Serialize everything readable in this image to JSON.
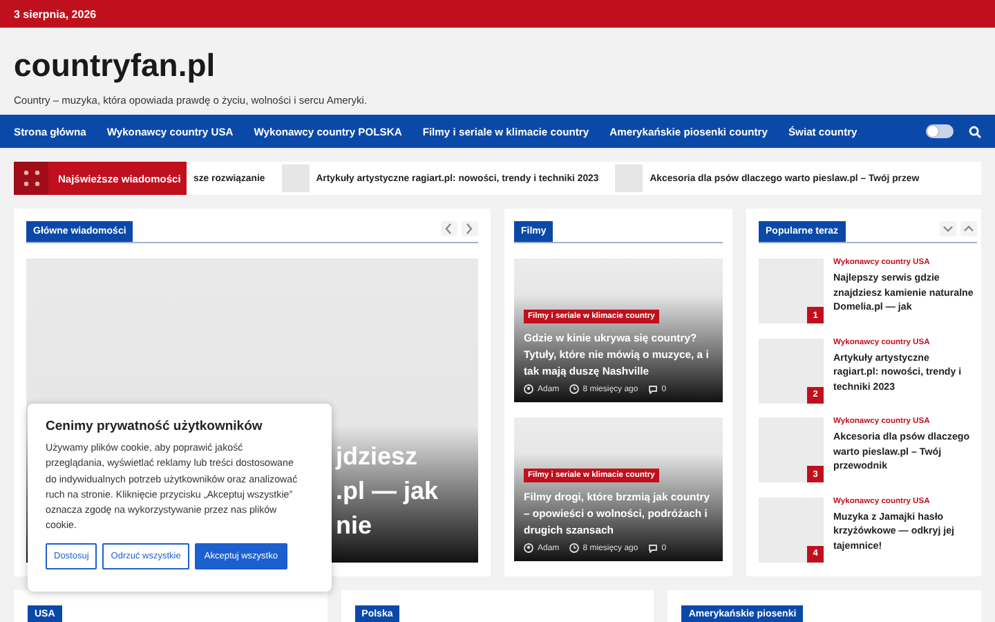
{
  "top_bar": {
    "date": "3 sierpnia, 2026"
  },
  "header": {
    "site_title": "countryfan.pl",
    "tagline": "Country – muzyka, która opowiada prawdę o życiu, wolności i sercu Ameryki."
  },
  "nav": {
    "items": [
      "Strona główna",
      "Wykonawcy country USA",
      "Wykonawcy country POLSKA",
      "Filmy i seriale w klimacie country",
      "Amerykańskie piosenki country",
      "Świat country"
    ],
    "dark_mode": false
  },
  "ticker": {
    "label": "Najświeższe wiadomości",
    "items": [
      {
        "title": "sze rozwiązanie",
        "thumbnail": false
      },
      {
        "title": "Artykuły artystyczne ragiart.pl: nowości, trendy i techniki 2023",
        "thumbnail": true
      },
      {
        "title": "Akcesoria dla psów dlaczego warto pieslaw.pl – Twój przew",
        "thumbnail": true
      }
    ]
  },
  "main_news": {
    "title": "Główne wiadomości",
    "slide_title_lines": [
      "jdziesz",
      ".pl — jak",
      "nie"
    ]
  },
  "films": {
    "title": "Filmy",
    "posts": [
      {
        "category": "Filmy i seriale w klimacie country",
        "title": "Gdzie w kinie ukrywa się country? Tytuły, które nie mówią o muzyce, a i tak mają duszę Nashville",
        "author": "Adam",
        "time": "8 miesięcy ago",
        "comments": "0"
      },
      {
        "category": "Filmy i seriale w klimacie country",
        "title": "Filmy drogi, które brzmią jak country – opowieści o wolności, podróżach i drugich szansach",
        "author": "Adam",
        "time": "8 miesięcy ago",
        "comments": "0"
      }
    ]
  },
  "popular": {
    "title": "Popularne teraz",
    "items": [
      {
        "rank": "1",
        "category": "Wykonawcy country USA",
        "title": "Najlepszy serwis gdzie znajdziesz kamienie naturalne Domelia.pl — jak"
      },
      {
        "rank": "2",
        "category": "Wykonawcy country USA",
        "title": "Artykuły artystyczne ragiart.pl: nowości, trendy i techniki 2023"
      },
      {
        "rank": "3",
        "category": "Wykonawcy country USA",
        "title": "Akcesoria dla psów dlaczego warto pieslaw.pl – Twój przewodnik"
      },
      {
        "rank": "4",
        "category": "Wykonawcy country USA",
        "title": "Muzyka z Jamajki hasło krzyżówkowe — odkryj jej tajemnice!"
      }
    ]
  },
  "sections": [
    "USA",
    "Polska",
    "Amerykańskie piosenki"
  ],
  "cookie": {
    "title": "Cenimy prywatność użytkowników",
    "text": "Używamy plików cookie, aby poprawić jakość przeglądania, wyświetlać reklamy lub treści dostosowane do indywidualnych potrzeb użytkowników oraz analizować ruch na stronie. Kliknięcie przycisku „Akceptuj wszystkie” oznacza zgodę na wykorzystywanie przez nas plików cookie.",
    "buttons": [
      {
        "label": "Dostosuj",
        "kind": "outline"
      },
      {
        "label": "Odrzuć wszystkie",
        "kind": "outline"
      },
      {
        "label": "Akceptuj wszystko",
        "kind": "primary"
      }
    ]
  }
}
